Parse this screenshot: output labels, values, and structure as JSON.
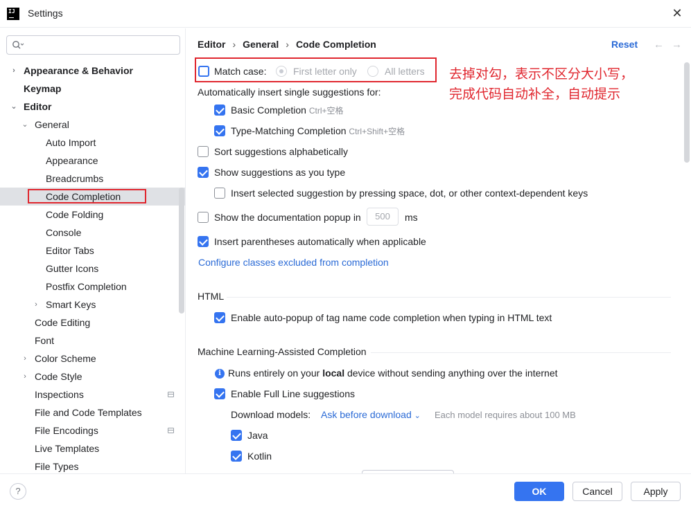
{
  "window": {
    "title": "Settings",
    "logo_text": "IJ",
    "close_glyph": "✕"
  },
  "search": {
    "placeholder": ""
  },
  "sidebar": {
    "items": [
      {
        "label": "Appearance & Behavior",
        "chevron": "›",
        "bold": true
      },
      {
        "label": "Keymap",
        "bold": true
      },
      {
        "label": "Editor",
        "chevron": "⌄",
        "bold": true
      },
      {
        "label": "General",
        "chevron": "⌄"
      },
      {
        "label": "Auto Import"
      },
      {
        "label": "Appearance"
      },
      {
        "label": "Breadcrumbs"
      },
      {
        "label": "Code Completion",
        "selected": true
      },
      {
        "label": "Code Folding"
      },
      {
        "label": "Console"
      },
      {
        "label": "Editor Tabs"
      },
      {
        "label": "Gutter Icons"
      },
      {
        "label": "Postfix Completion"
      },
      {
        "label": "Smart Keys",
        "chevron": "›"
      },
      {
        "label": "Code Editing"
      },
      {
        "label": "Font"
      },
      {
        "label": "Color Scheme",
        "chevron": "›"
      },
      {
        "label": "Code Style",
        "chevron": "›"
      },
      {
        "label": "Inspections",
        "icon": "project-scope-icon"
      },
      {
        "label": "File and Code Templates"
      },
      {
        "label": "File Encodings",
        "icon": "project-scope-icon"
      },
      {
        "label": "Live Templates"
      },
      {
        "label": "File Types"
      }
    ]
  },
  "breadcrumb": {
    "part1": "Editor",
    "part2": "General",
    "part3": "Code Completion",
    "separator": "›"
  },
  "header": {
    "reset_label": "Reset",
    "back_glyph": "←",
    "forward_glyph": "→"
  },
  "options": {
    "match_case": {
      "label": "Match case:",
      "checked": false
    },
    "first_letter_only": "First letter only",
    "all_letters": "All letters",
    "auto_insert_title": "Automatically insert single suggestions for:",
    "basic_completion": {
      "label": "Basic Completion",
      "shortcut": "Ctrl+空格",
      "checked": true
    },
    "type_matching": {
      "label": "Type-Matching Completion",
      "shortcut": "Ctrl+Shift+空格",
      "checked": true
    },
    "sort_alpha": {
      "label": "Sort suggestions alphabetically",
      "checked": false
    },
    "show_as_type": {
      "label": "Show suggestions as you type",
      "checked": true
    },
    "insert_selected": {
      "label": "Insert selected suggestion by pressing space, dot, or other context-dependent keys",
      "checked": false
    },
    "doc_popup": {
      "label": "Show the documentation popup in",
      "value": "500",
      "unit": "ms",
      "checked": false
    },
    "insert_parens": {
      "label": "Insert parentheses automatically when applicable",
      "checked": true
    },
    "configure_link": "Configure classes excluded from completion"
  },
  "html_section": {
    "title": "HTML",
    "auto_popup": {
      "label": "Enable auto-popup of tag name code completion when typing in HTML text",
      "checked": true
    }
  },
  "ml_section": {
    "title": "Machine Learning-Assisted Completion",
    "info_pre": "Runs entirely on your ",
    "info_bold": "local",
    "info_post": " device without sending anything over the internet",
    "full_line": {
      "label": "Enable Full Line suggestions",
      "checked": true
    },
    "download_label": "Download models:",
    "download_value": "Ask before download",
    "download_hint": "Each model requires about 100 MB",
    "java": {
      "label": "Java",
      "checked": true
    },
    "kotlin": {
      "label": "Kotlin",
      "checked": true
    }
  },
  "annotation": {
    "line1": "去掉对勾，表示不区分大小写，",
    "line2": "完成代码自动补全，自动提示",
    "color": "#e0262e"
  },
  "footer": {
    "help_glyph": "?",
    "ok_label": "OK",
    "cancel_label": "Cancel",
    "apply_label": "Apply"
  },
  "colors": {
    "accent": "#3574f0",
    "link": "#2a6ad6",
    "annotation_red": "#e0262e",
    "selection": "#dfe1e5"
  }
}
